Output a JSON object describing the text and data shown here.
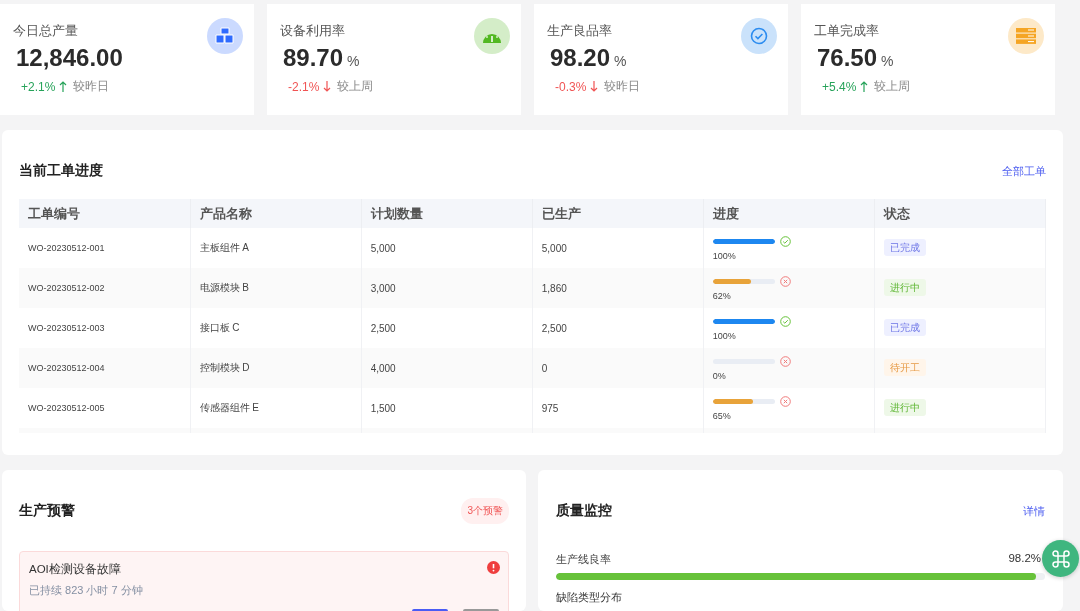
{
  "kpis": [
    {
      "title": "今日总产量",
      "value": "12,846.00",
      "delta": "+2.1%",
      "rising": true,
      "compare": "较昨日",
      "color": "#2f6bff"
    },
    {
      "title": "设备利用率",
      "value": "89.70",
      "unit": "%",
      "delta": "-2.1%",
      "rising": false,
      "compare": "较上周",
      "color": "#52b822"
    },
    {
      "title": "生产良品率",
      "value": "98.20",
      "unit": "%",
      "delta": "-0.3%",
      "rising": false,
      "compare": "较昨日",
      "color": "#2b8cf0"
    },
    {
      "title": "工单完成率",
      "value": "76.50",
      "unit": "%",
      "delta": "+5.4%",
      "rising": true,
      "compare": "较上周",
      "color": "#f5a524"
    }
  ],
  "orders": {
    "title": "当前工单进度",
    "link": "全部工单",
    "columns": [
      "工单编号",
      "产品名称",
      "计划数量",
      "已生产",
      "进度",
      "状态"
    ],
    "rows": [
      {
        "id": "WO-20230512-001",
        "product": "主板组件 A",
        "planned": "5,000",
        "produced": "5,000",
        "level": 1,
        "percent": "100%",
        "complete": true,
        "status": "已完成",
        "kind": "done"
      },
      {
        "id": "WO-20230512-002",
        "product": "电源模块 B",
        "planned": "3,000",
        "produced": "1,860",
        "level": 0.62,
        "percent": "62%",
        "complete": false,
        "status": "进行中",
        "kind": "active"
      },
      {
        "id": "WO-20230512-003",
        "product": "接口板 C",
        "planned": "2,500",
        "produced": "2,500",
        "level": 1,
        "percent": "100%",
        "complete": true,
        "status": "已完成",
        "kind": "done"
      },
      {
        "id": "WO-20230512-004",
        "product": "控制模块 D",
        "planned": "4,000",
        "produced": "0",
        "level": 0,
        "percent": "0%",
        "complete": false,
        "status": "待开工",
        "kind": "pending"
      },
      {
        "id": "WO-20230512-005",
        "product": "传感器组件 E",
        "planned": "1,500",
        "produced": "975",
        "level": 0.65,
        "percent": "65%",
        "complete": false,
        "status": "进行中",
        "kind": "active"
      }
    ]
  },
  "alerts": {
    "title": "生产预警",
    "badge": "3个预警",
    "items": [
      {
        "title": "AOI检测设备故障",
        "duration": "已持续 823 小时 7 分钟"
      }
    ]
  },
  "quality": {
    "title": "质量监控",
    "link": "详情",
    "metrics": [
      {
        "label": "生产线良率",
        "reading": "98.2%",
        "level": 0.982
      }
    ],
    "next_section": "缺陷类型分布"
  }
}
